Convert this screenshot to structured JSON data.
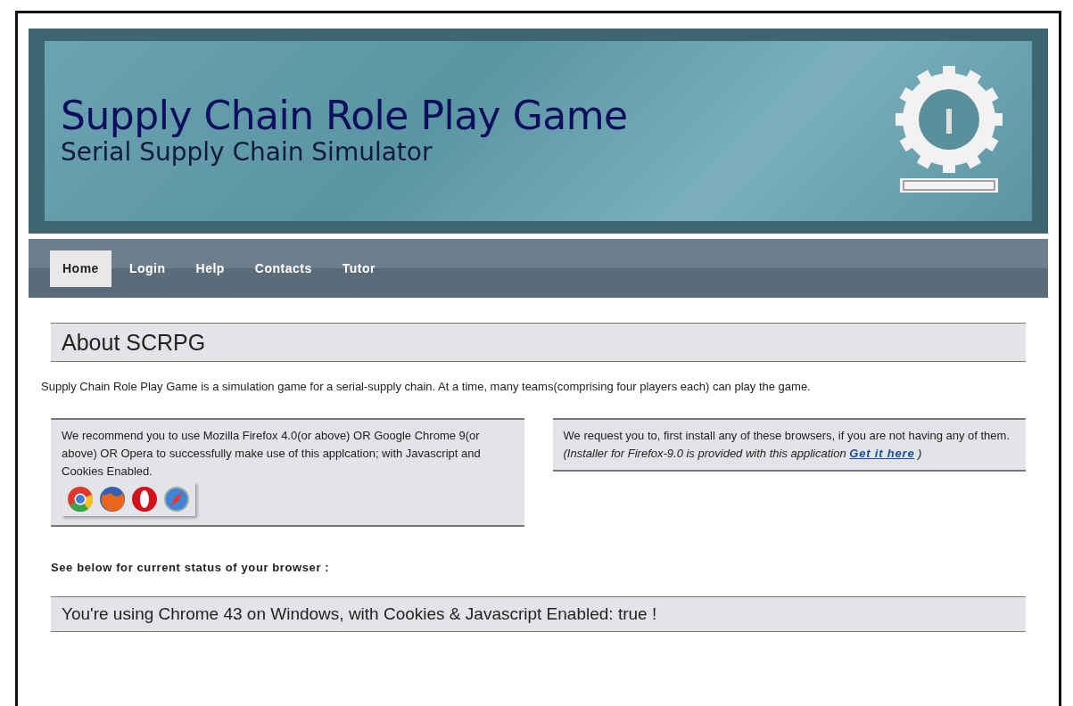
{
  "header": {
    "title": "Supply Chain Role Play Game",
    "subtitle": "Serial Supply Chain Simulator"
  },
  "nav": [
    {
      "label": "Home",
      "selected": true
    },
    {
      "label": "Login",
      "selected": false
    },
    {
      "label": "Help",
      "selected": false
    },
    {
      "label": "Contacts",
      "selected": false
    },
    {
      "label": "Tutor",
      "selected": false
    }
  ],
  "section_title": "About SCRPG",
  "intro": "Supply Chain Role Play Game is a simulation game for a serial-supply chain. At a time, many teams(comprising four players each) can play the game.",
  "recommend_box": {
    "text": "We recommend you to use Mozilla Firefox 4.0(or above) OR Google Chrome 9(or above) OR Opera to successfully make use of this applcation; with Javascript and Cookies Enabled.",
    "browsers": [
      {
        "kind": "chrome"
      },
      {
        "kind": "firefox"
      },
      {
        "kind": "opera"
      },
      {
        "kind": "safari"
      }
    ]
  },
  "request_box": {
    "text": "We request you to, first install any of these browsers, if you are not having any of them.",
    "note": "(Installer for Firefox-9.0 is provided with this application",
    "link": "Get it here",
    "note_end": ")"
  },
  "status_label": "See below for current status of your browser :",
  "status": "You're using Chrome 43 on Windows, with Cookies & Javascript Enabled: true !"
}
